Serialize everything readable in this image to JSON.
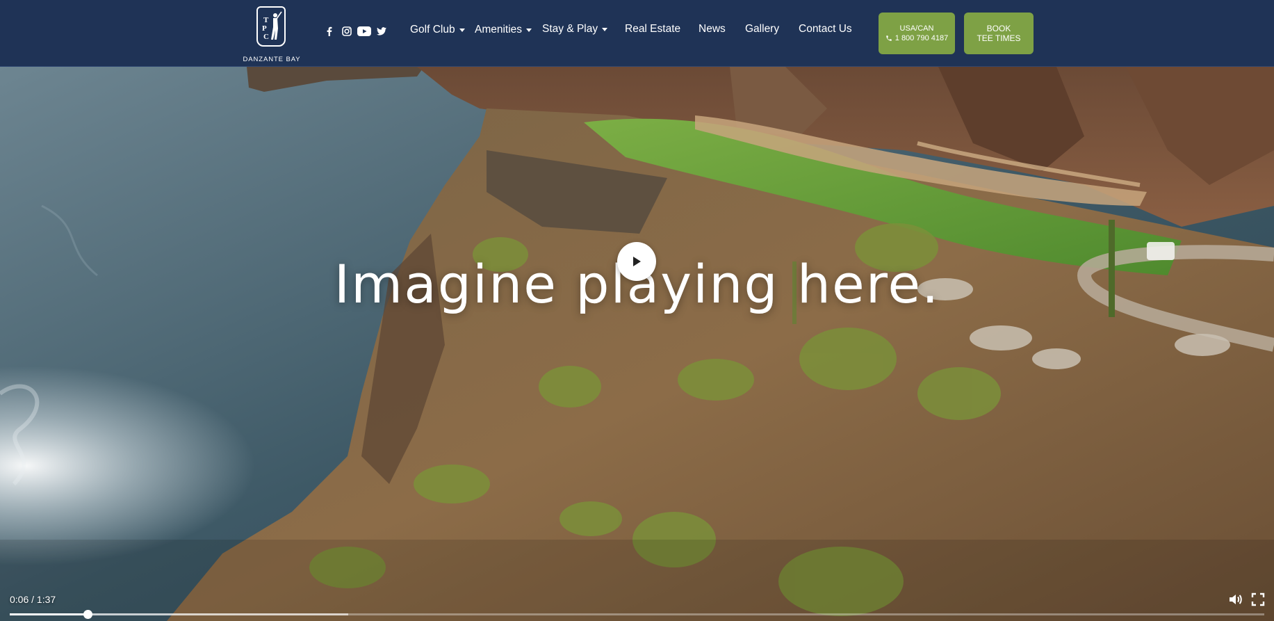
{
  "brand": {
    "logo_mark": "TPC",
    "name": "DANZANTE BAY"
  },
  "social": [
    {
      "icon": "facebook-icon"
    },
    {
      "icon": "instagram-icon"
    },
    {
      "icon": "youtube-icon"
    },
    {
      "icon": "twitter-icon"
    }
  ],
  "nav": {
    "golf_club": "Golf Club",
    "amenities": "Amenities",
    "stay_play": "Stay & Play",
    "real_estate": "Real Estate",
    "news": "News",
    "gallery": "Gallery",
    "contact": "Contact Us"
  },
  "cta": {
    "phone_region": "USA/CAN",
    "phone_number": "1 800 790 4187",
    "book_line1": "BOOK",
    "book_line2": "TEE TIMES"
  },
  "hero": {
    "headline": "Imagine playing here."
  },
  "video": {
    "time_display": "0:06 / 1:37",
    "progress_fraction": 0.062,
    "buffered_fraction": 0.27
  },
  "colors": {
    "header_bg": "#1f3356",
    "accent_green": "#7ea145",
    "text": "#ffffff"
  }
}
